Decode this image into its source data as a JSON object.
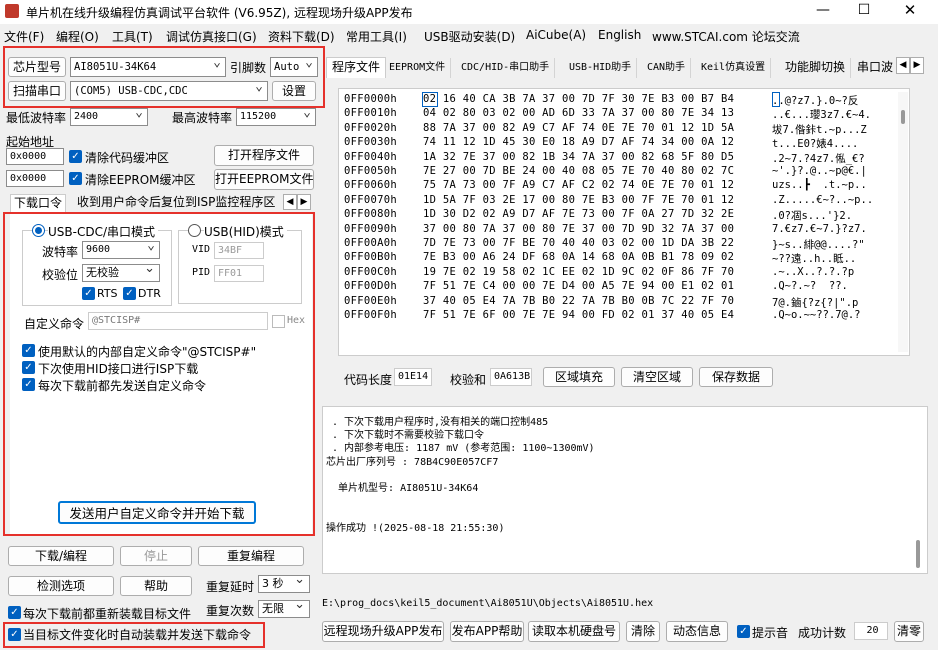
{
  "title": "单片机在线升级编程仿真调试平台软件 (V6.95Z), 远程现场升级APP发布",
  "menu": [
    "文件(F)",
    "编程(O)",
    "工具(T)",
    "调试仿真接口(G)",
    "资料下载(D)",
    "常用工具(I)",
    "USB驱动安装(D)",
    "AiCube(A)",
    "English",
    "www.STCAI.com 论坛交流"
  ],
  "left": {
    "chip_label": "芯片型号",
    "chip_value": "AI8051U-34K64",
    "pin_label": "引脚数",
    "pin_value": "Auto",
    "scan_label": "扫描串口",
    "port_value": "(COM5) USB-CDC,CDC",
    "settings": "设置",
    "min_baud_label": "最低波特率",
    "min_baud": "2400",
    "max_baud_label": "最高波特率",
    "max_baud": "115200",
    "start_addr_label": "起始地址",
    "addr1": "0x0000",
    "clear_code": "清除代码缓冲区",
    "open_prog": "打开程序文件",
    "addr2": "0x0000",
    "clear_eeprom": "清除EEPROM缓冲区",
    "open_eeprom": "打开EEPROM文件",
    "tabs": [
      "下载口令",
      "收到用户命令后复位到ISP监控程序区"
    ],
    "cdc_mode": "USB-CDC/串口模式",
    "hid_mode": "USB(HID)模式",
    "baud_label": "波特率",
    "baud_value": "9600",
    "check_label": "校验位",
    "check_value": "无校验",
    "rts": "RTS",
    "dtr": "DTR",
    "vid_label": "VID",
    "vid": "34BF",
    "pid_label": "PID",
    "pid": "FF01",
    "custom_label": "自定义命令",
    "custom_value": "@STCISP#",
    "hex_label": "Hex",
    "opt1": "使用默认的内部自定义命令\"@STCISP#\"",
    "opt2": "下次使用HID接口进行ISP下载",
    "opt3": "每次下载前都先发送自定义命令",
    "send_btn": "发送用户自定义命令并开始下载",
    "download": "下载/编程",
    "stop": "停止",
    "reprogram": "重复编程",
    "check_opts": "检测选项",
    "help": "帮助",
    "delay_label": "重复延时",
    "delay_value": "3 秒",
    "reload": "每次下载前都重新装载目标文件",
    "count_label": "重复次数",
    "count_value": "无限",
    "autoload": "当目标文件变化时自动装载并发送下载命令"
  },
  "right": {
    "tabs": [
      "程序文件",
      "EEPROM文件",
      "CDC/HID-串口助手",
      "USB-HID助手",
      "CAN助手",
      "Keil仿真设置",
      "功能脚切换",
      "串口波"
    ],
    "hex_rows": [
      {
        "addr": "0FF0000h",
        "bytes": "02 16 40 CA 3B 7A 37 00 7D 7F 30 7E B3 00 B7 B4",
        "ascii": "..@?z7.}.0~?反"
      },
      {
        "addr": "0FF0010h",
        "bytes": "04 02 80 03 02 00 AD 6D 33 7A 37 00 80 7E 34 13",
        "ascii": "..€...瓔3z7.€~4."
      },
      {
        "addr": "0FF0020h",
        "bytes": "88 7A 37 00 82 A9 C7 AF 74 0E 7E 70 01 12 1D 5A",
        "ascii": "坺7.偺鉲t.~p...Z"
      },
      {
        "addr": "0FF0030h",
        "bytes": "74 11 12 1D 45 30 E0 18 A9 D7 AF 74 34 00 0A 12",
        "ascii": "t...E0?婊4...."
      },
      {
        "addr": "0FF0040h",
        "bytes": "1A 32 7E 37 00 82 1B 34 7A 37 00 82 68 5F 80 D5",
        "ascii": ".2~7.?4z7.俬_€?"
      },
      {
        "addr": "0FF0050h",
        "bytes": "7E 27 00 7D BE 24 00 40 08 05 7E 70 40 80 02 7C",
        "ascii": "~'.}?.@..~p@€.|"
      },
      {
        "addr": "0FF0060h",
        "bytes": "75 7A 73 00 7F A9 C7 AF C2 02 74 0E 7E 70 01 12",
        "ascii": "uzs..┣  .t.~p.."
      },
      {
        "addr": "0FF0070h",
        "bytes": "1D 5A 7F 03 2E 17 00 80 7E B3 00 7F 7E 70 01 12",
        "ascii": ".Z.....€~?..~p.."
      },
      {
        "addr": "0FF0080h",
        "bytes": "1D 30 D2 02 A9 D7 AF 7E 73 00 7F 0A 27 7D 32 2E",
        "ascii": ".0?凅s...'}2."
      },
      {
        "addr": "0FF0090h",
        "bytes": "37 00 80 7A 37 00 80 7E 37 00 7D 9D 32 7A 37 00",
        "ascii": "7.€z7.€~7.}?z7."
      },
      {
        "addr": "0FF00A0h",
        "bytes": "7D 7E 73 00 7F BE 70 40 40 03 02 00 1D DA 3B 22",
        "ascii": "}~s..緋@@....?\""
      },
      {
        "addr": "0FF00B0h",
        "bytes": "7E B3 00 A6 24 DF 68 0A 14 68 0A 0B B1 78 09 02",
        "ascii": "~??遠..h..眡.."
      },
      {
        "addr": "0FF00C0h",
        "bytes": "19 7E 02 19 58 02 1C EE 02 1D 9C 02 0F 86 7F 70",
        "ascii": ".~..X..?.?.?p"
      },
      {
        "addr": "0FF00D0h",
        "bytes": "7F 51 7E C4 00 00 7E D4 00 A5 7E 94 00 E1 02 01",
        "ascii": ".Q~?.~?  ??."
      },
      {
        "addr": "0FF00E0h",
        "bytes": "37 40 05 E4 7A 7B B0 22 7A 7B B0 0B 7C 22 7F 70",
        "ascii": "7@.鏀{?z{?|\".p"
      },
      {
        "addr": "0FF00F0h",
        "bytes": "7F 51 7E 6F 00 7E 7E 94 00 FD 02 01 37 40 05 E4",
        "ascii": ".Q~o.~~??.7@.?"
      }
    ],
    "code_len_label": "代码长度",
    "code_len": "01E14",
    "checksum_label": "校验和",
    "checksum": "0A613B",
    "fill_btn": "区域填充",
    "clear_btn": "清空区域",
    "save_btn": "保存数据",
    "log": [
      " . 下次下载用户程序时,没有相关的端口控制485",
      " . 下次下载时不需要校验下载口令",
      " . 内部参考电压: 1187 mV (参考范围: 1100~1300mV)",
      "芯片出厂序列号 : 78B4C90E057CF7",
      "",
      "  单片机型号: AI8051U-34K64",
      "",
      "",
      "操作成功 !(2025-08-18 21:55:30)"
    ],
    "path": "E:\\prog_docs\\keil5_document\\Ai8051U\\Objects\\Ai8051U.hex",
    "bottom_btns": [
      "远程现场升级APP发布",
      "发布APP帮助",
      "读取本机硬盘号",
      "清除",
      "动态信息"
    ],
    "sound": "提示音",
    "success_label": "成功计数",
    "success_count": "20",
    "zero_btn": "清零"
  }
}
